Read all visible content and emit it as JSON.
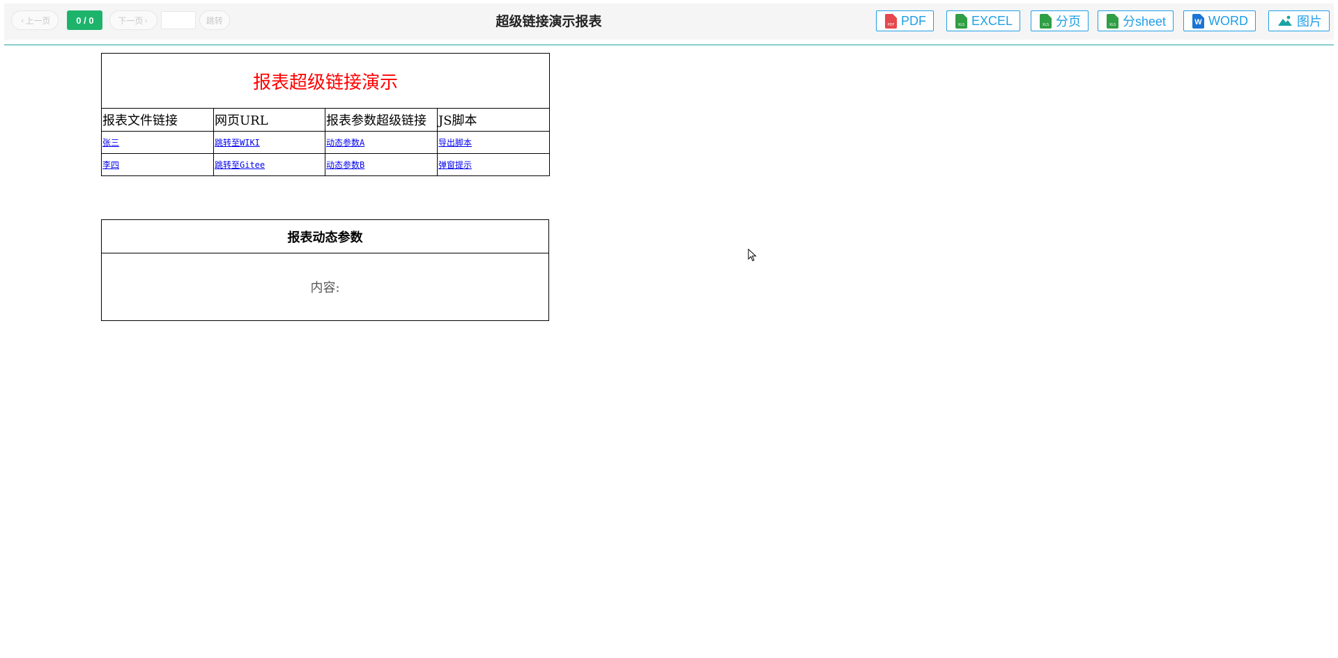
{
  "pager": {
    "prev_label": "上一页",
    "current": "0 / 0",
    "next_label": "下一页",
    "jump_value": "",
    "go_label": "跳转"
  },
  "header": {
    "title": "超级链接演示报表"
  },
  "exports": [
    {
      "label": "PDF",
      "icon": "pdf-file-icon",
      "tag": "PDF"
    },
    {
      "label": "EXCEL",
      "icon": "excel-file-icon",
      "tag": "XLS"
    },
    {
      "label": "分页",
      "icon": "excel-file-icon",
      "tag": "XLS"
    },
    {
      "label": "分sheet",
      "icon": "excel-file-icon",
      "tag": "XLS"
    },
    {
      "label": "WORD",
      "icon": "word-file-icon",
      "tag": "W"
    },
    {
      "label": "图片",
      "icon": "image-mountain-icon"
    }
  ],
  "report": {
    "title": "报表超级链接演示",
    "columns": [
      "报表文件链接",
      "网页URL",
      "报表参数超级链接",
      "JS脚本"
    ],
    "rows": [
      [
        "张三",
        "跳转至WIKI",
        "动态参数A",
        "导出脚本"
      ],
      [
        "李四",
        "跳转至Gitee",
        "动态参数B",
        "弹窗提示"
      ]
    ]
  },
  "params": {
    "title": "报表动态参数",
    "content": "内容:"
  },
  "colors": {
    "accent_green": "#1db36b",
    "export_blue": "#1e9ee6",
    "title_red": "#ff0000",
    "link_blue": "#0000ee",
    "divider_teal": "#1fa2a2"
  }
}
